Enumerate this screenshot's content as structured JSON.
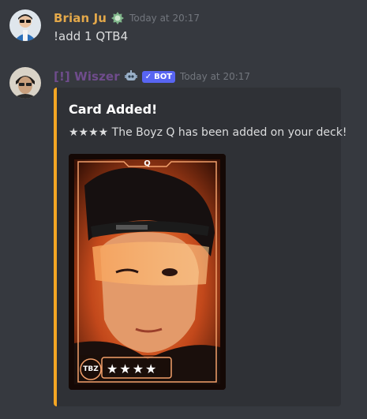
{
  "colors": {
    "background": "#36393f",
    "embed_background": "#2f3136",
    "embed_accent": "#f5a623",
    "user1_name": "#e3a84a",
    "bot_name": "#6f4c8c",
    "bot_badge": "#5865f2",
    "timestamp": "#72767d",
    "text": "#dcddde"
  },
  "messages": [
    {
      "author": "Brian Ju",
      "role_icon": "green-role-icon",
      "timestamp": "Today at 20:17",
      "content": "!add 1 QTB4"
    },
    {
      "author": "[!] Wiszer",
      "role_icon": "robot-icon",
      "badge": "BOT",
      "timestamp": "Today at 20:17",
      "embed": {
        "title": "Card Added!",
        "description": "★★★★ The Boyz Q has been added on your deck!",
        "card": {
          "label": "Q",
          "group_logo": "TBZ",
          "stars": "★★★★"
        }
      }
    }
  ]
}
